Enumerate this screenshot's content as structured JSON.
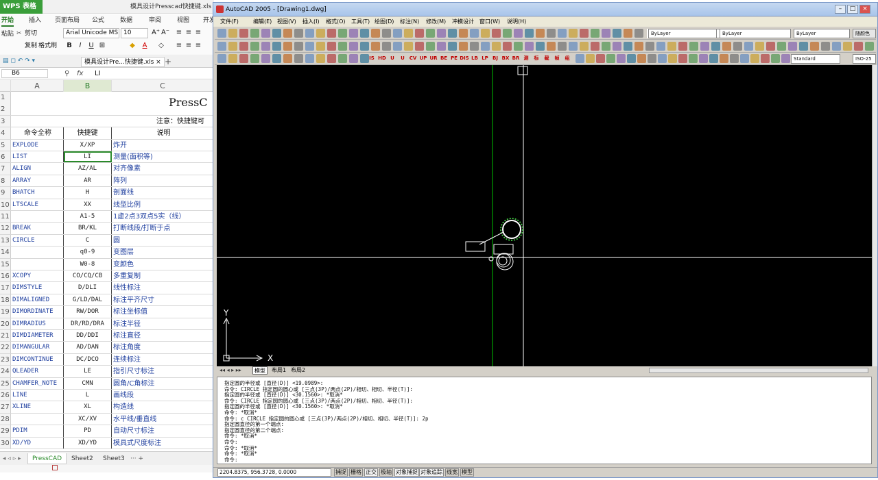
{
  "wps": {
    "app_label": "WPS 表格",
    "file_title": "模具设计Presscad快捷键.xls [兼",
    "tabs": [
      "开始",
      "插入",
      "页面布局",
      "公式",
      "数据",
      "审阅",
      "视图",
      "开发"
    ],
    "ribbon": {
      "cut": "剪切",
      "copy": "复制",
      "format_painter": "格式刷",
      "paste": "粘贴",
      "font_name": "Arial Unicode MS",
      "font_size": "10"
    },
    "doc_tab": "模具设计Pre...快捷键.xls",
    "cell_ref": "B6",
    "fx": "fx",
    "formula_value": "LI",
    "columns": [
      "A",
      "B",
      "C"
    ],
    "title_cell": "PressC",
    "note_cell": "注意：快捷键可",
    "header": {
      "num": "4",
      "a": "命令全称",
      "b": "快捷键",
      "c": "说明"
    },
    "rows": [
      {
        "n": "5",
        "a": "EXPLODE",
        "b": "X/XP",
        "c": "炸开"
      },
      {
        "n": "6",
        "a": "LIST",
        "b": "LI",
        "c": "测量(面积等)"
      },
      {
        "n": "7",
        "a": "ALIGN",
        "b": "AZ/AL",
        "c": "对齐像素"
      },
      {
        "n": "8",
        "a": "ARRAY",
        "b": "AR",
        "c": "阵列"
      },
      {
        "n": "9",
        "a": "BHATCH",
        "b": "H",
        "c": "剖面线"
      },
      {
        "n": "10",
        "a": "LTSCALE",
        "b": "XX",
        "c": "线型比例"
      },
      {
        "n": "11",
        "a": "",
        "b": "A1-5",
        "c": "1虚2点3双点5实（线）"
      },
      {
        "n": "12",
        "a": "BREAK",
        "b": "BR/KL",
        "c": "打断线段/打断于点"
      },
      {
        "n": "13",
        "a": "CIRCLE",
        "b": "C",
        "c": "圆"
      },
      {
        "n": "14",
        "a": "",
        "b": "q0-9",
        "c": "变图层"
      },
      {
        "n": "15",
        "a": "",
        "b": "W0-8",
        "c": "变颜色"
      },
      {
        "n": "16",
        "a": "XCOPY",
        "b": "CO/CQ/CB",
        "c": "多重复制"
      },
      {
        "n": "17",
        "a": "DIMSTYLE",
        "b": "D/DLI",
        "c": "线性标注"
      },
      {
        "n": "18",
        "a": "DIMALIGNED",
        "b": "G/LD/DAL",
        "c": "标注平齐尺寸"
      },
      {
        "n": "19",
        "a": "DIMORDINATE",
        "b": "RW/DOR",
        "c": "标注坐标值"
      },
      {
        "n": "20",
        "a": "DIMRADIUS",
        "b": "DR/RD/DRA",
        "c": "标注半径"
      },
      {
        "n": "21",
        "a": "DIMDIAMETER",
        "b": "DD/DDI",
        "c": "标注直径"
      },
      {
        "n": "22",
        "a": "DIMANGULAR",
        "b": "AD/DAN",
        "c": "标注角度"
      },
      {
        "n": "23",
        "a": "DIMCONTINUE",
        "b": "DC/DCO",
        "c": "连续标注"
      },
      {
        "n": "24",
        "a": "QLEADER",
        "b": "LE",
        "c": "指引尺寸标注"
      },
      {
        "n": "25",
        "a": "CHAMFER_NOTE",
        "b": "CMN",
        "c": "圆角/C角标注"
      },
      {
        "n": "26",
        "a": "LINE",
        "b": "L",
        "c": "画线段"
      },
      {
        "n": "27",
        "a": "XLINE",
        "b": "XL",
        "c": "构造线"
      },
      {
        "n": "28",
        "a": "",
        "b": "XC/XV",
        "c": "水平线/垂直线"
      },
      {
        "n": "29",
        "a": "PDIM",
        "b": "PD",
        "c": "自动尺寸标注"
      },
      {
        "n": "30",
        "a": "XD/YD",
        "b": "XD/YD",
        "c": "模具式尺度标注"
      }
    ],
    "sheets": [
      "PressCAD",
      "Sheet2",
      "Sheet3"
    ]
  },
  "acad": {
    "title": "AutoCAD 2005 - [Drawing1.dwg]",
    "menu": [
      "文件(F)",
      "编辑(E)",
      "视图(V)",
      "插入(I)",
      "格式(O)",
      "工具(T)",
      "绘图(D)",
      "标注(N)",
      "修改(M)",
      "冲模设计",
      "窗口(W)",
      "说明(H)"
    ],
    "layer_value": "0",
    "color_value": "ByLayer",
    "linetype_value": "ByLayer",
    "lineweight_value": "ByLayer",
    "plotstyle_value": "随颜色",
    "textstyle_value": "Standard",
    "dimstyle_value": "ISO-25",
    "pc_buttons": [
      "IS",
      "HD",
      "U",
      "U",
      "CV",
      "UP",
      "UR",
      "BE",
      "PE",
      "DIS",
      "LB",
      "LP",
      "BJ",
      "BX",
      "BR",
      "测",
      "标",
      "截",
      "帧",
      "组"
    ],
    "ucs": {
      "x": "X",
      "y": "Y"
    },
    "layout_tabs": [
      "模型",
      "布局1",
      "布局2"
    ],
    "command_lines": [
      "指定圆的半径或 [直径(D)] <19.0989>:",
      "命令:  CIRCLE 指定圆的圆心或 [三点(3P)/两点(2P)/相切、相切、半径(T)]:",
      "指定圆的半径或 [直径(D)] <30.1560>: *取消*",
      "命令:  CIRCLE 指定圆的圆心或 [三点(3P)/两点(2P)/相切、相切、半径(T)]:",
      "指定圆的半径或 [直径(D)] <30.1560>: *取消*",
      "命令: *取消*",
      "命令: c CIRCLE 指定圆的圆心或 [三点(3P)/两点(2P)/相切、相切、半径(T)]: 2p",
      "指定圆直径的第一个端点:",
      "指定圆直径的第二个端点:",
      "命令: *取消*",
      "命令:",
      "命令: *取消*",
      "命令: *取消*",
      "命令:"
    ],
    "coords": "2204.8375, 956.3728, 0.0000",
    "status_buttons": [
      "捕捉",
      "栅格",
      "正交",
      "极轴",
      "对象捕捉",
      "对象追踪",
      "线宽",
      "模型"
    ],
    "colors": {
      "canvas": "#000000",
      "green_line": "#00c000",
      "circle": "#40c040",
      "white_line": "#ffffff"
    }
  }
}
